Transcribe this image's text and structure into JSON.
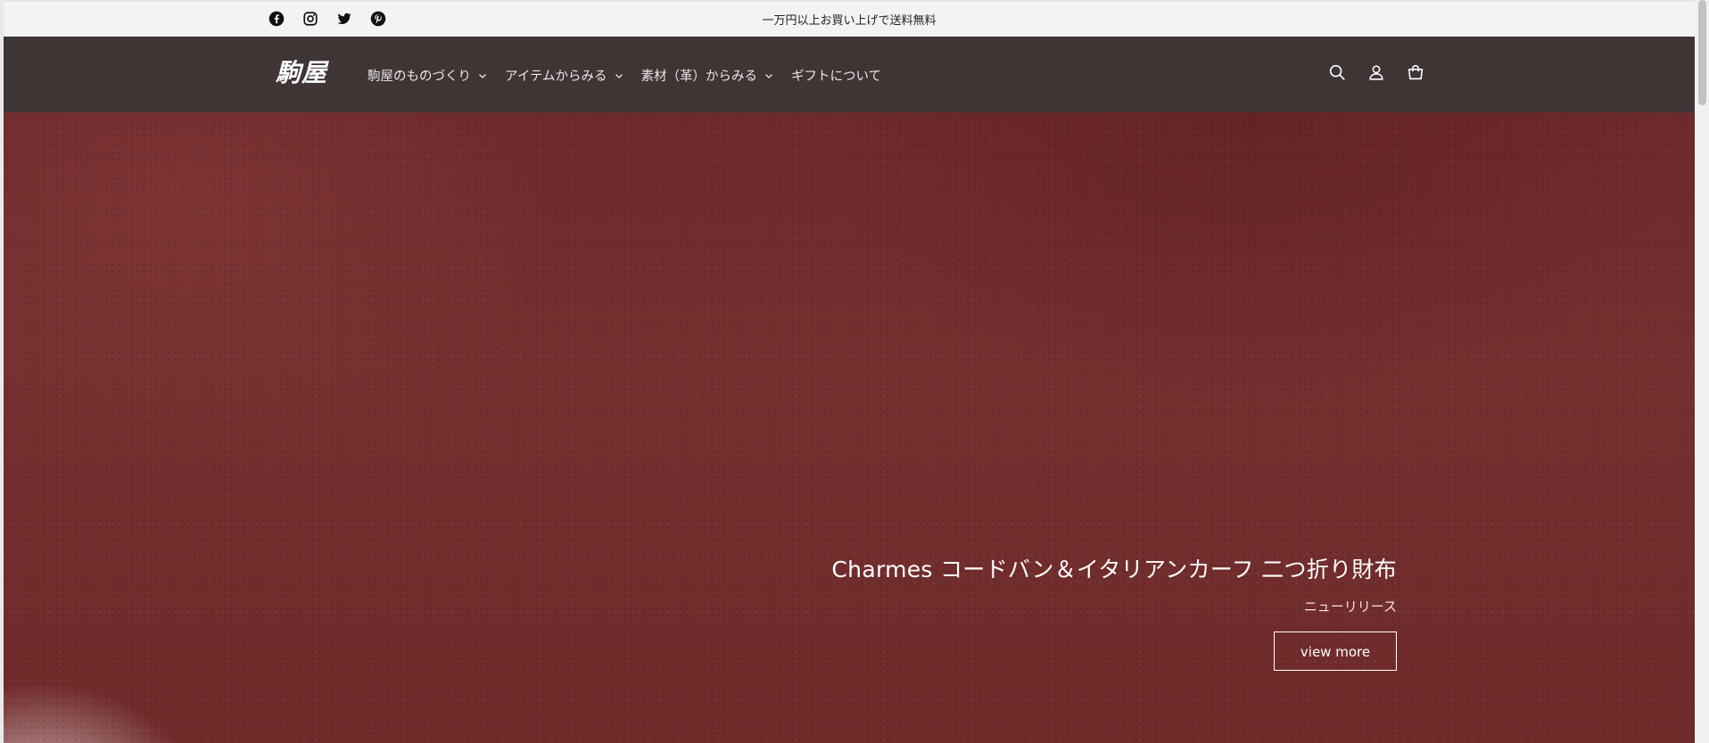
{
  "announcement": {
    "text": "一万円以上お買い上げで送料無料"
  },
  "socials": [
    "facebook-icon",
    "instagram-icon",
    "twitter-icon",
    "pinterest-icon"
  ],
  "header": {
    "logo": "駒屋",
    "nav": [
      {
        "label": "駒屋のものづくり",
        "has_dropdown": true
      },
      {
        "label": "アイテムからみる",
        "has_dropdown": true
      },
      {
        "label": "素材（革）からみる",
        "has_dropdown": true
      },
      {
        "label": "ギフトについて",
        "has_dropdown": false
      }
    ],
    "icons": [
      "search-icon",
      "account-icon",
      "cart-icon"
    ]
  },
  "hero": {
    "title": "Charmes コードバン＆イタリアンカーフ 二つ折り財布",
    "subtitle": "ニューリリース",
    "button": "view more"
  },
  "colors": {
    "header_bg": "#3f3535",
    "announcement_bg": "#f3f3f3",
    "hero_bg": "#722d2d",
    "text_light": "#ffffff"
  }
}
